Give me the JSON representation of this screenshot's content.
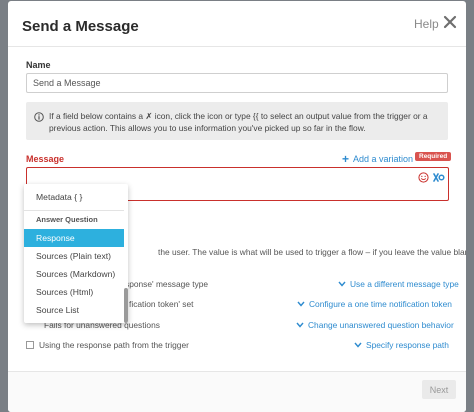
{
  "modal": {
    "title": "Send a Message",
    "help_label": "Help",
    "close_icon": "close-icon"
  },
  "name_field": {
    "label": "Name",
    "value": "Send a Message"
  },
  "info": {
    "icon": "info-icon",
    "text_line1": "If a field below contains a ✗ icon, click the icon or type {{ to select an output value from the trigger or a",
    "text_line2": "previous action. This allows you to use information you've picked up so far in the flow."
  },
  "message_field": {
    "label": "Message",
    "add_variation_label": "Add a variation",
    "required_badge": "Required",
    "value": "",
    "emoji_icon": "emoji-icon",
    "variable_icon": "variable-icon"
  },
  "dropdown": {
    "top_item": "Metadata { }",
    "section_heading": "Answer Question",
    "items": [
      {
        "label": "Response",
        "selected": true
      },
      {
        "label": "Sources (Plain text)",
        "selected": false
      },
      {
        "label": "Sources (Markdown)",
        "selected": false
      },
      {
        "label": "Sources (Html)",
        "selected": false
      },
      {
        "label": "Source List",
        "selected": false
      }
    ]
  },
  "help_text": "the user. The value is what will be used to trigger a flow – if you leave the value blank,",
  "rows": [
    {
      "text": "the 'response' message type",
      "link": "Use a different message type"
    },
    {
      "text": "fication token' set",
      "link": "Configure a one time notification token"
    },
    {
      "text": "Fails for unanswered questions",
      "link": "Change unanswered question behavior"
    },
    {
      "text": "Using the response path from the trigger",
      "link": "Specify response path"
    }
  ],
  "footer": {
    "next_label": "Next"
  },
  "colors": {
    "accent_blue": "#2e8bcf",
    "error_red": "#c9302c",
    "selected_item": "#2db0de"
  }
}
